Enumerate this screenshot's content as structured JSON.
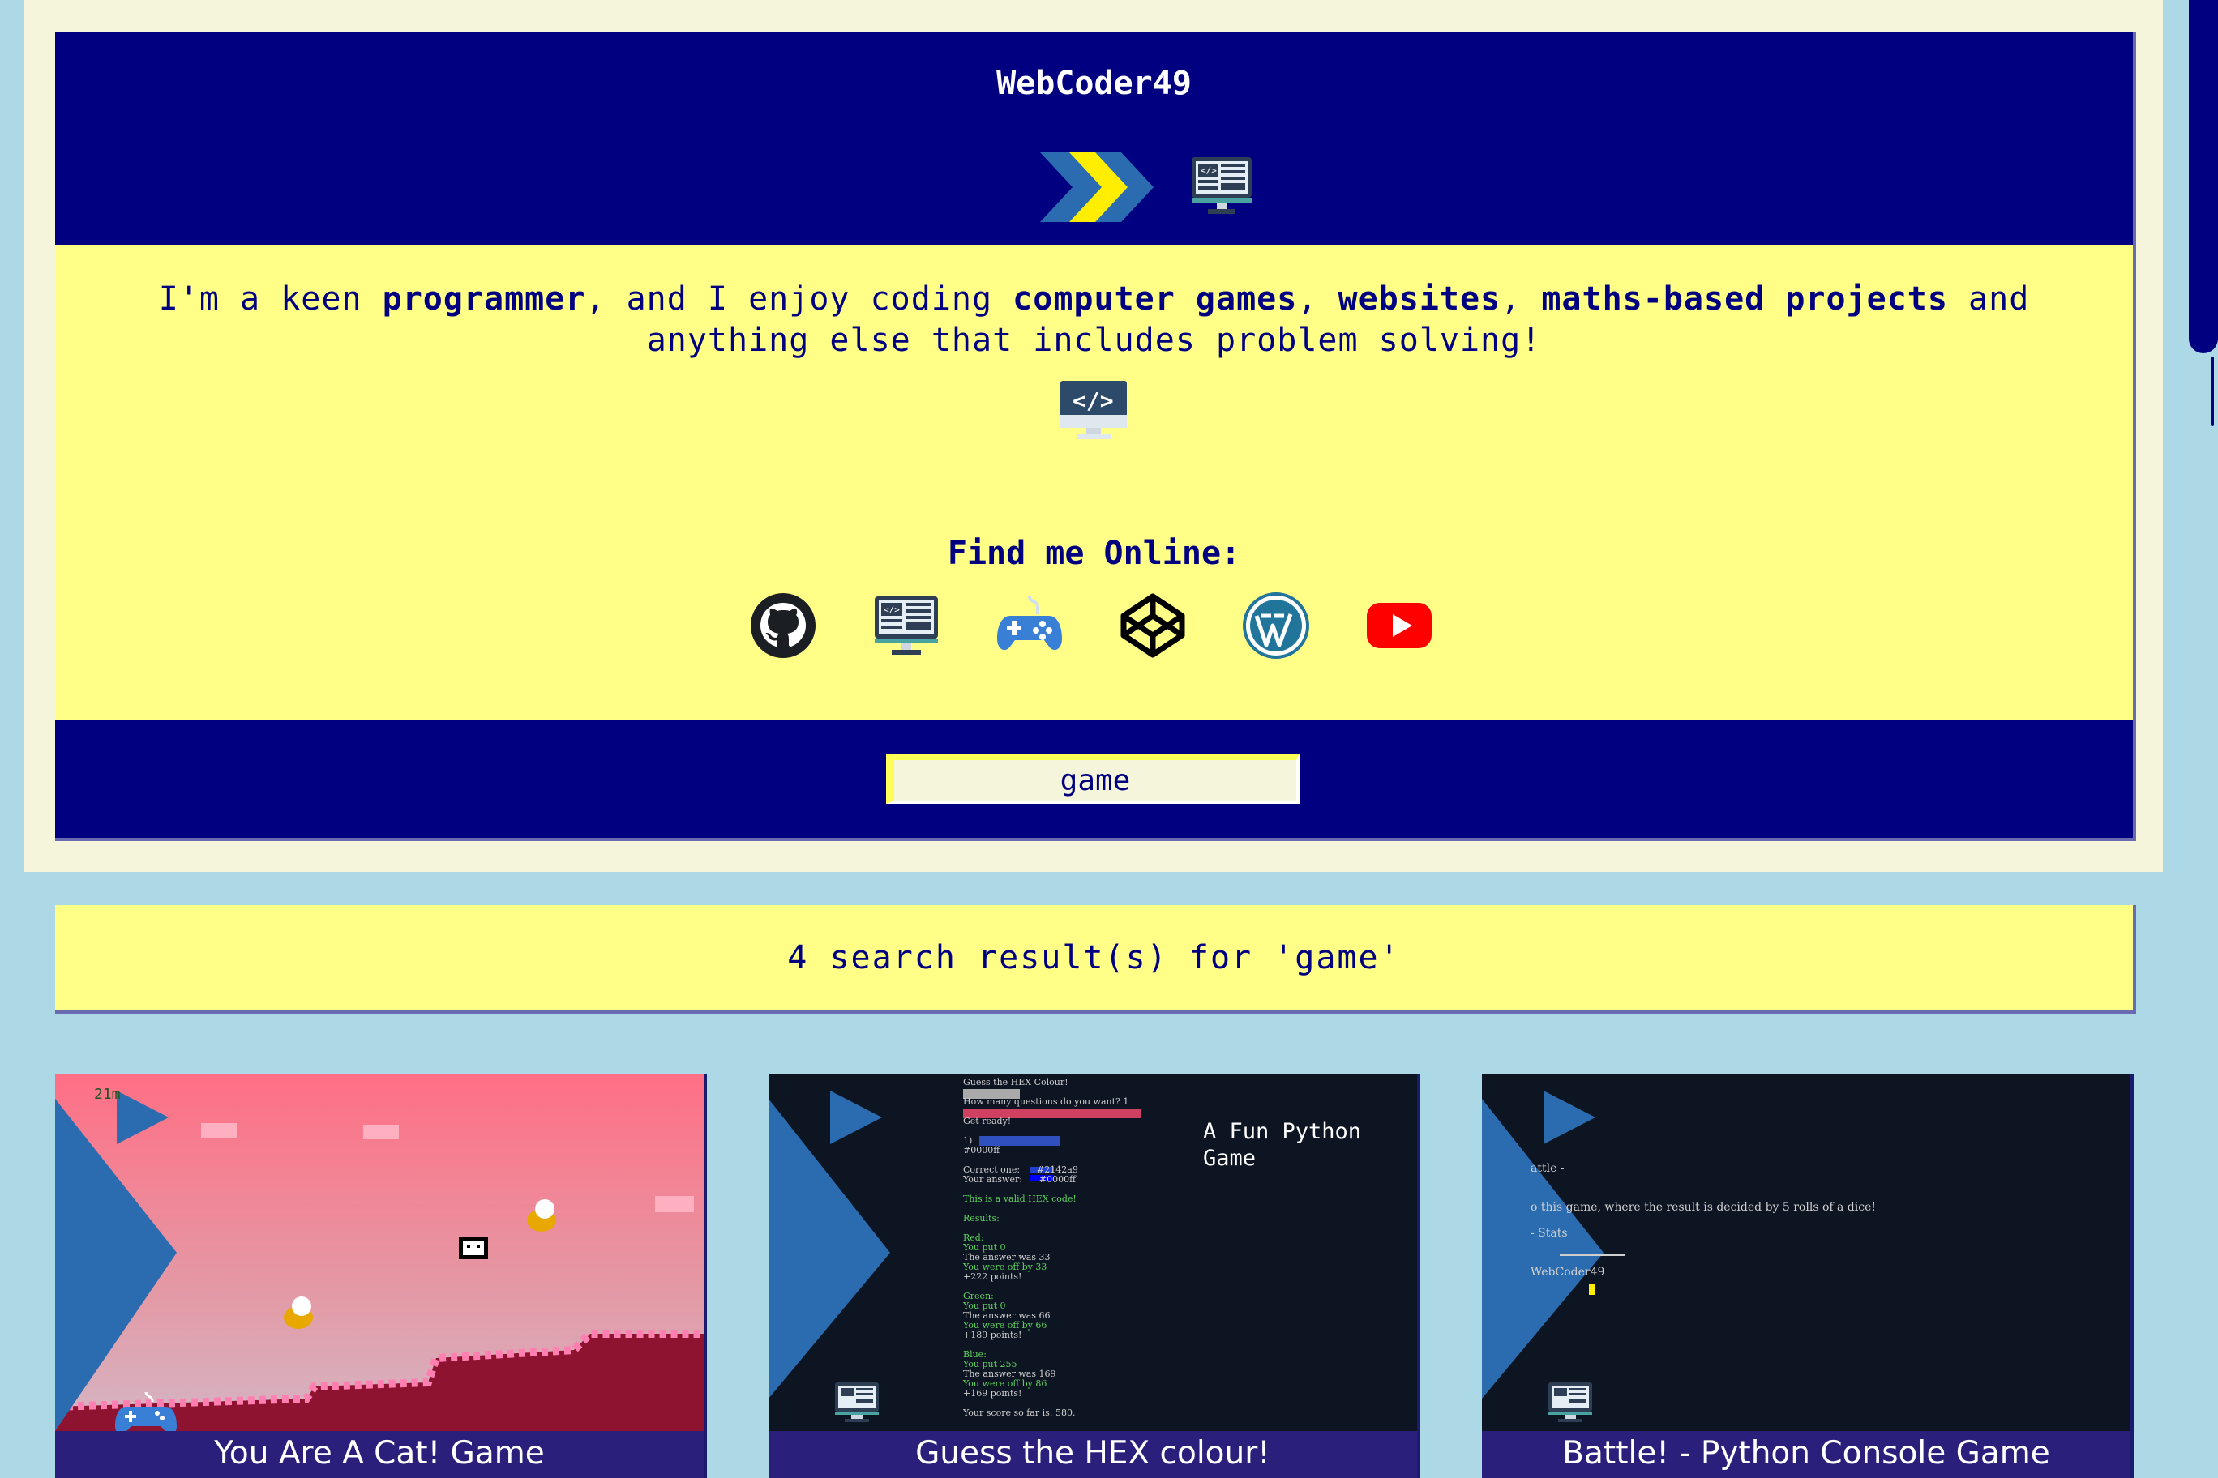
{
  "header": {
    "title": "WebCoder49",
    "logo_icons": [
      "arrows-logo-icon",
      "computer-icon"
    ]
  },
  "about": {
    "intro_parts": [
      {
        "text": "I'm a keen ",
        "bold": false
      },
      {
        "text": "programmer",
        "bold": true
      },
      {
        "text": ", and I enjoy coding ",
        "bold": false
      },
      {
        "text": "computer games",
        "bold": true
      },
      {
        "text": ", ",
        "bold": false
      },
      {
        "text": "websites",
        "bold": true
      },
      {
        "text": ", ",
        "bold": false
      },
      {
        "text": "maths-based projects",
        "bold": true
      },
      {
        "text": " and anything else that includes problem solving!",
        "bold": false
      }
    ],
    "code_icon": "code-monitor-icon",
    "find_me_label": "Find me Online:",
    "social_links": [
      {
        "name": "github",
        "icon": "github-icon"
      },
      {
        "name": "website",
        "icon": "computer-icon"
      },
      {
        "name": "games",
        "icon": "gamepad-icon"
      },
      {
        "name": "codepen",
        "icon": "codepen-icon"
      },
      {
        "name": "wordpress",
        "icon": "wordpress-icon"
      },
      {
        "name": "youtube",
        "icon": "youtube-icon"
      }
    ]
  },
  "search": {
    "value": "game"
  },
  "results": {
    "summary": "4 search result(s) for 'game'",
    "cards": [
      {
        "title": "You Are A Cat! Game",
        "type_icon": "gamepad-icon",
        "distance_label": "21m"
      },
      {
        "title": "Guess the HEX colour!",
        "type_icon": "computer-icon",
        "subtitle": "A Fun Python Game"
      },
      {
        "title": "Battle! - Python Console Game",
        "type_icon": "computer-icon"
      }
    ]
  },
  "colors": {
    "navy": "#000080",
    "pale_yellow": "#ffff88",
    "beige": "#f5f5dc",
    "light_blue": "#add8e6",
    "play_blue": "#2b6cb0"
  },
  "terminal": {
    "hex_game": [
      "Guess the HEX Colour!",
      "How many questions do you want? 1",
      "Get ready!",
      "1) ",
      "#0000ff",
      "Correct one:      #2142a9",
      "Your answer:      #0000ff",
      "This is a valid HEX code!",
      "Results:",
      "Red:",
      "You put 0",
      "The answer was 33",
      "You were off by 33",
      "+222 points!",
      "Green:",
      "You put 0",
      "The answer was 66",
      "You were off by 66",
      "+189 points!",
      "Blue:",
      "You put 255",
      "The answer was 169",
      "You were off by 86",
      "+169 points!",
      "Your score so far is: 580."
    ],
    "battle_game": [
      "attle -",
      "o this game, where the result is decided by 5 rolls of a dice!",
      "- Stats",
      "WebCoder49"
    ]
  }
}
